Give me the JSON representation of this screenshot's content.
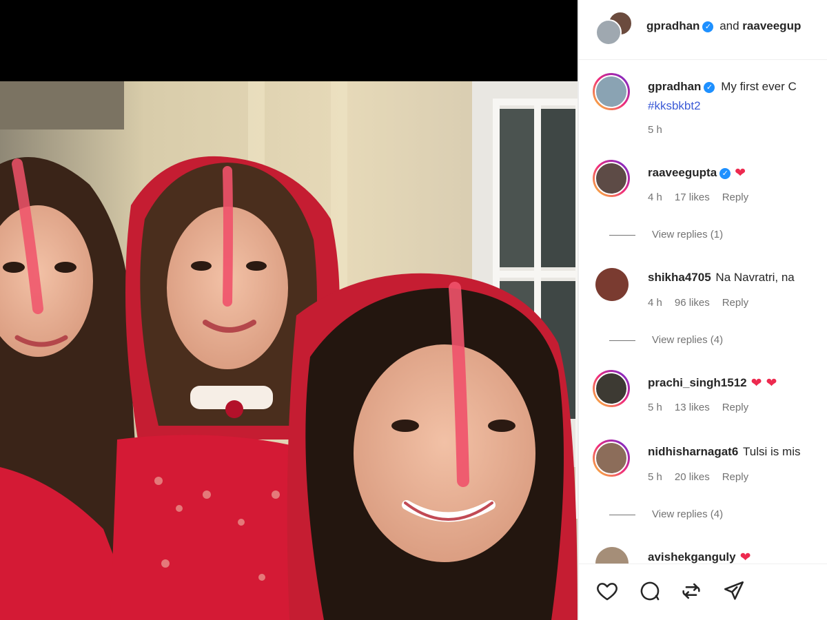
{
  "post": {
    "header_text": {
      "user1": "gpradhan",
      "and_text": "and",
      "user2": "raaveegup"
    }
  },
  "caption": {
    "username": "gpradhan",
    "text": "My first ever C",
    "hashtag": "#kksbkbt2",
    "time": "5 h"
  },
  "comments": [
    {
      "username": "raaveegupta",
      "verified": true,
      "text": "",
      "hearts": 1,
      "time": "4 h",
      "likes": "17 likes",
      "reply": "Reply",
      "view_replies": "View replies (1)"
    },
    {
      "username": "shikha4705",
      "verified": false,
      "text": "Na Navratri, na",
      "hearts": 0,
      "time": "4 h",
      "likes": "96 likes",
      "reply": "Reply",
      "view_replies": "View replies (4)"
    },
    {
      "username": "prachi_singh1512",
      "verified": false,
      "text": "",
      "hearts": 2,
      "time": "5 h",
      "likes": "13 likes",
      "reply": "Reply",
      "view_replies": ""
    },
    {
      "username": "nidhisharnagat6",
      "verified": false,
      "text": "Tulsi is mis",
      "hearts": 0,
      "time": "5 h",
      "likes": "20 likes",
      "reply": "Reply",
      "view_replies": "View replies (4)"
    },
    {
      "username": "avishekganguly",
      "verified": false,
      "text": "",
      "hearts": 1,
      "time": "",
      "likes": "",
      "reply": "",
      "view_replies": ""
    }
  ],
  "actions": {
    "like_icon": "heart-outline-icon",
    "comment_icon": "comment-bubble-icon",
    "share_icon": "repost-icon",
    "send_icon": "paper-plane-icon"
  },
  "colors": {
    "accent_blue": "#3b5ad6",
    "verified_blue": "#1e90ff",
    "heart_red": "#ed2a4f",
    "sindoor": "#f0526a",
    "dress_red": "#d41a35"
  }
}
